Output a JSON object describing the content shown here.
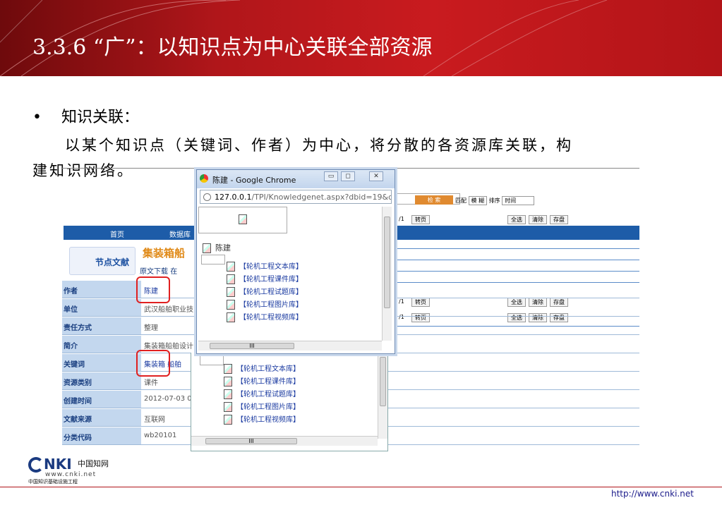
{
  "slide": {
    "title": "3.3.6 “广”：以知识点为中心关联全部资源",
    "bullet": "知识关联：",
    "para_line1": "以某个知识点（关键词、作者）为中心，将分散的各资源库关联，构",
    "para_line2": "建知识网络。",
    "footer_url": "http://www.cnki.net",
    "colors": {
      "header": "#c91b1f",
      "nav": "#1d5ca8",
      "highlight": "#e02020"
    }
  },
  "logo": {
    "mark": "NKI",
    "zh": "中国知网",
    "www": "www.cnki.net",
    "sub": "中国知识基础设施工程"
  },
  "background_page": {
    "search_button": "检 索",
    "match_label": "匹配",
    "match_value": "模 糊",
    "sort_label": "排序",
    "sort_value": "时间",
    "pager1": {
      "page": "/1",
      "jump": "转页",
      "select_all": "全选",
      "clear": "清除",
      "save": "存盘"
    },
    "pager2": {
      "page": "/1",
      "jump": "转页",
      "select_all": "全选",
      "clear": "清除",
      "save": "存盘"
    },
    "pager3": {
      "page": "/1",
      "jump": "转页",
      "select_all": "全选",
      "clear": "清除",
      "save": "存盘"
    },
    "nav": {
      "home": "首页",
      "db": "数据库"
    },
    "banner": {
      "label": "节点文献",
      "title": "集装箱船",
      "download": "原文下载",
      "online": "在"
    },
    "rows": [
      {
        "key": "作者",
        "value": "陈建"
      },
      {
        "key": "单位",
        "value": "武汉船舶职业技"
      },
      {
        "key": "责任方式",
        "value": "整理"
      },
      {
        "key": "简介",
        "value": "集装箱船舶设计"
      },
      {
        "key": "关键词",
        "value": "集装箱 船舶"
      },
      {
        "key": "资源类别",
        "value": "课件"
      },
      {
        "key": "创建时间",
        "value": "2012-07-03 0"
      },
      {
        "key": "文献来源",
        "value": "互联网"
      },
      {
        "key": "分类代码",
        "value": "wb20101"
      }
    ]
  },
  "popup": {
    "window_title": "陈建 - Google Chrome",
    "url_domain": "127.0.0.1",
    "url_path": "/TPI/Knowledgenet.aspx?dbid=19&dl",
    "node": "陈建",
    "links": [
      "【轮机工程文本库】",
      "【轮机工程课件库】",
      "【轮机工程试题库】",
      "【轮机工程图片库】",
      "【轮机工程视频库】"
    ],
    "hscroll_thumb": "III"
  },
  "popup2": {
    "links": [
      "【轮机工程文本库】",
      "【轮机工程课件库】",
      "【轮机工程试题库】",
      "【轮机工程图片库】",
      "【轮机工程视频库】"
    ],
    "hscroll_thumb": "III"
  }
}
